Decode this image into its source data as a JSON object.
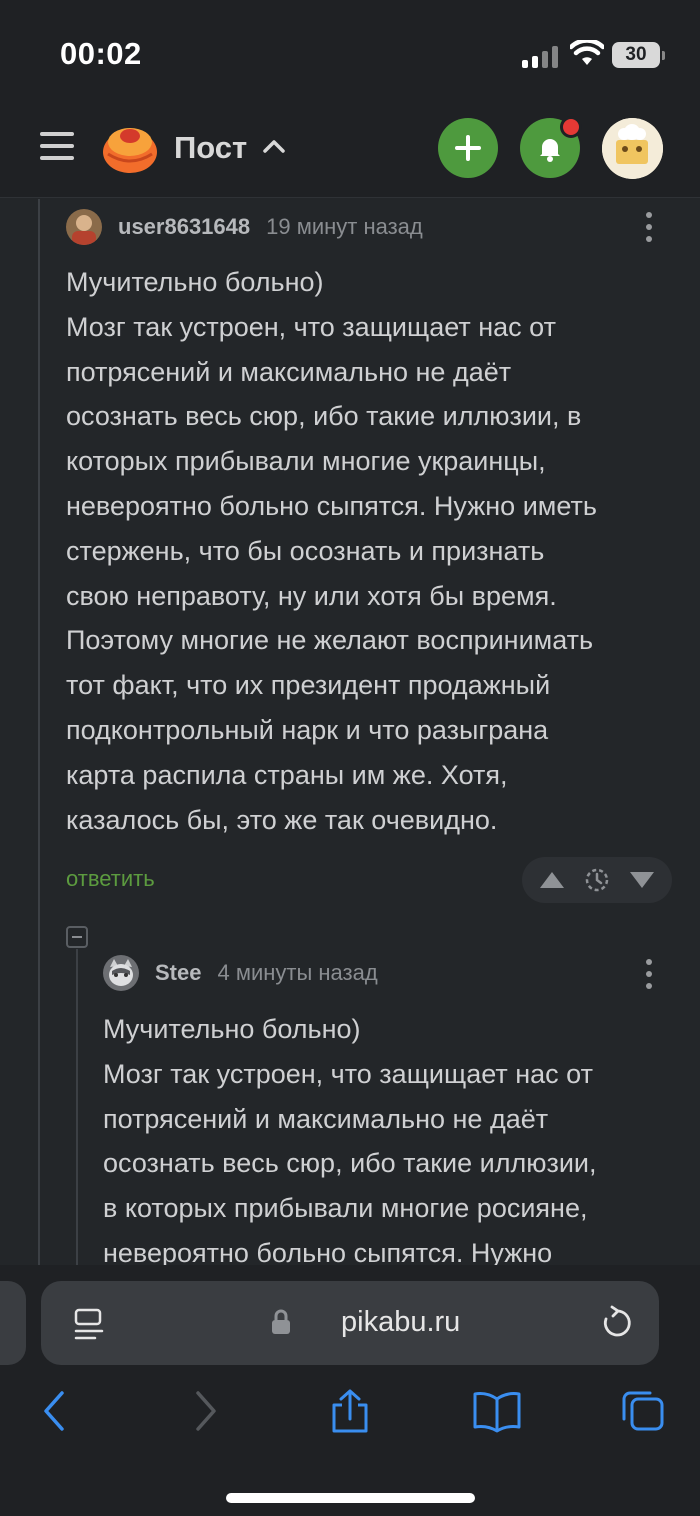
{
  "status_bar": {
    "time": "00:02",
    "battery": "30"
  },
  "header": {
    "title": "Пост"
  },
  "comments": [
    {
      "user": "user8631648",
      "time": "19 минут назад",
      "lines": [
        "Мучительно больно)",
        "Мозг так устроен, что защищает нас от",
        "потрясений и максимально не даёт",
        "осознать весь сюр, ибо такие иллюзии, в",
        "которых прибывали многие украинцы,",
        "невероятно больно сыпятся. Нужно иметь",
        "стержень, что бы осознать и признать",
        "свою неправоту, ну или хотя бы время.",
        "Поэтому многие не желают воспринимать",
        "тот факт, что их президент продажный",
        "подконтрольный нарк и что разыграна",
        "карта распила страны им же. Хотя,",
        "казалось бы, это же так очевидно."
      ],
      "reply_label": "ответить"
    },
    {
      "user": "Stee",
      "time": "4 минуты назад",
      "lines": [
        "Мучительно больно)",
        "Мозг так устроен, что защищает нас от",
        "потрясений и максимально не даёт",
        "осознать весь сюр, ибо такие иллюзии,",
        "в которых прибывали многие росияне,",
        "невероятно больно сыпятся. Нужно"
      ]
    }
  ],
  "browser": {
    "url": "pikabu.ru"
  },
  "colors": {
    "accent_green": "#4e9a3e",
    "notification_red": "#e53935",
    "reply_green": "#5c9b3f"
  }
}
